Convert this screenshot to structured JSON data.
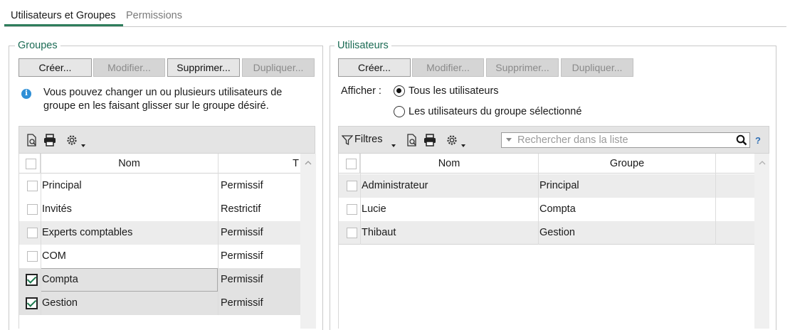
{
  "tabs": {
    "active": "Utilisateurs et Groupes",
    "inactive": "Permissions"
  },
  "groups": {
    "legend": "Groupes",
    "buttons": {
      "create": "Créer...",
      "modify": "Modifier...",
      "delete": "Supprimer...",
      "duplicate": "Dupliquer..."
    },
    "info": "Vous pouvez changer un ou plusieurs utilisateurs de groupe en les faisant glisser sur le groupe désiré.",
    "columns": {
      "name": "Nom",
      "type": "T"
    },
    "rows": [
      {
        "name": "Principal",
        "type": "Permissif",
        "checked": false
      },
      {
        "name": "Invités",
        "type": "Restrictif",
        "checked": false
      },
      {
        "name": "Experts comptables",
        "type": "Permissif",
        "checked": false
      },
      {
        "name": "COM",
        "type": "Permissif",
        "checked": false
      },
      {
        "name": "Compta",
        "type": "Permissif",
        "checked": true
      },
      {
        "name": "Gestion",
        "type": "Permissif",
        "checked": true
      }
    ]
  },
  "users": {
    "legend": "Utilisateurs",
    "buttons": {
      "create": "Créer...",
      "modify": "Modifier...",
      "delete": "Supprimer...",
      "duplicate": "Dupliquer..."
    },
    "show_label": "Afficher :",
    "radio_all": "Tous les utilisateurs",
    "radio_group": "Les utilisateurs du groupe sélectionné",
    "filters_label": "Filtres",
    "search_placeholder": "Rechercher dans la liste",
    "help": "?",
    "columns": {
      "name": "Nom",
      "group": "Groupe"
    },
    "rows": [
      {
        "name": "Administrateur",
        "group": "Principal"
      },
      {
        "name": "Lucie",
        "group": "Compta"
      },
      {
        "name": "Thibaut",
        "group": "Gestion"
      }
    ]
  },
  "colors": {
    "accent": "#2e7d5b",
    "legend": "#1b6b54",
    "info": "#2f8fd6",
    "check": "#1e7b4f"
  }
}
